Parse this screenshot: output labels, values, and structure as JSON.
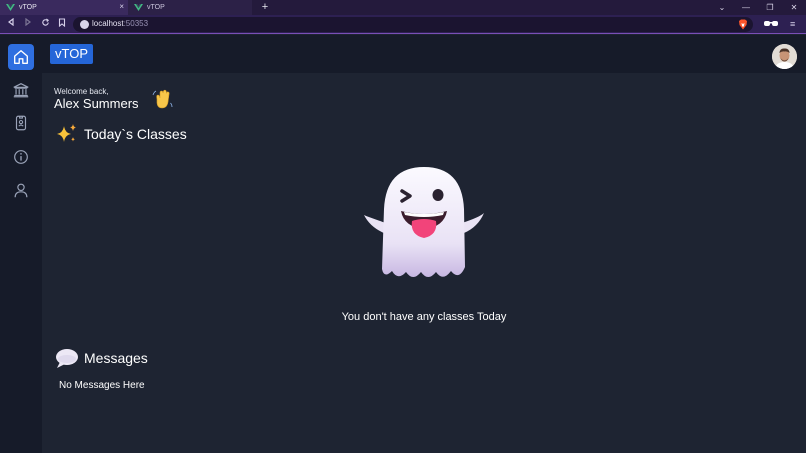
{
  "browser": {
    "tabs": [
      {
        "label": "vTOP",
        "active": true
      },
      {
        "label": "vTOP",
        "active": false
      }
    ],
    "new_tab_symbol": "+",
    "close_symbol": "×",
    "url_host": "localhost",
    "url_port": ":50353",
    "window_controls": [
      "⌄",
      "—",
      "❐",
      "✕"
    ],
    "icons": [
      "back-icon",
      "forward-icon",
      "reload-icon",
      "bookmark-icon",
      "site-info-icon",
      "brave-shield-icon",
      "extension-icon",
      "menu-icon"
    ]
  },
  "app": {
    "brand": "vTOP",
    "sidebar": [
      {
        "name": "home",
        "icon": "home-icon",
        "active": true
      },
      {
        "name": "institution",
        "icon": "bank-icon",
        "active": false
      },
      {
        "name": "id-card",
        "icon": "id-card-icon",
        "active": false
      },
      {
        "name": "info",
        "icon": "info-icon",
        "active": false
      },
      {
        "name": "profile",
        "icon": "user-icon",
        "active": false
      }
    ],
    "welcome_label": "Welcome back,",
    "user_name": "Alex Summers",
    "classes_title": "Today`s Classes",
    "no_classes_text": "You don't have any classes Today",
    "messages_title": "Messages",
    "no_messages_text": "No Messages Here"
  },
  "colors": {
    "accent": "#2f6fe0",
    "background": "#1e2432",
    "sidebar": "#161b29",
    "browser_frame": "#2d2052"
  }
}
